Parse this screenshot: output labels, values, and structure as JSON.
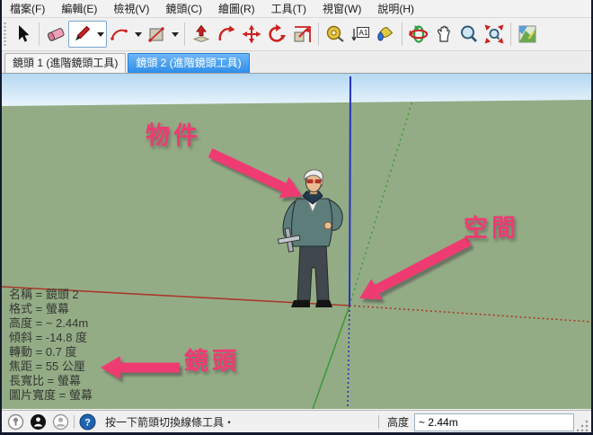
{
  "menu": {
    "items": [
      "檔案(F)",
      "編輯(E)",
      "檢視(V)",
      "鏡頭(C)",
      "繪圖(R)",
      "工具(T)",
      "視窗(W)",
      "說明(H)"
    ]
  },
  "toolbar": {
    "tools": [
      "select",
      "eraser",
      "line",
      "arc",
      "shape",
      "push-pull",
      "follow-me",
      "move",
      "rotate",
      "scale",
      "tape-measure",
      "text",
      "paint-bucket",
      "orbit",
      "pan",
      "zoom",
      "zoom-extents",
      "add-location"
    ],
    "selected_tool": "line",
    "text_tool_glyph": "A1"
  },
  "tabs": {
    "items": [
      {
        "label": "鏡頭 1 (進階鏡頭工具)",
        "active": false
      },
      {
        "label": "鏡頭 2 (進階鏡頭工具)",
        "active": true
      }
    ],
    "active_color": "#2f8ee8"
  },
  "viewport": {
    "camera_info": {
      "lines": [
        "名稱 = 鏡頭 2",
        "格式 = 螢幕",
        "高度 = ~ 2.44m",
        "傾斜 = -14.8 度",
        "轉動 = 0.7 度",
        "焦距 = 55 公厘",
        "長寬比 = 螢幕",
        "圖片寬度 = 螢幕"
      ]
    },
    "annotations": {
      "object_label": "物件",
      "space_label": "空間",
      "camera_label": "鏡頭",
      "color": "#ee3b72"
    },
    "colors": {
      "sky_top": "#b5d8f1",
      "sky_horizon": "#eef7fd",
      "ground": "#94ac85",
      "axis_red": "#a8392b",
      "axis_green": "#3c9a3c",
      "axis_blue": "#2633bb"
    }
  },
  "status_bar": {
    "hint": "按一下箭頭切換線條工具‧",
    "help_glyph": "?",
    "field_label": "高度",
    "field_value": "~ 2.44m"
  }
}
